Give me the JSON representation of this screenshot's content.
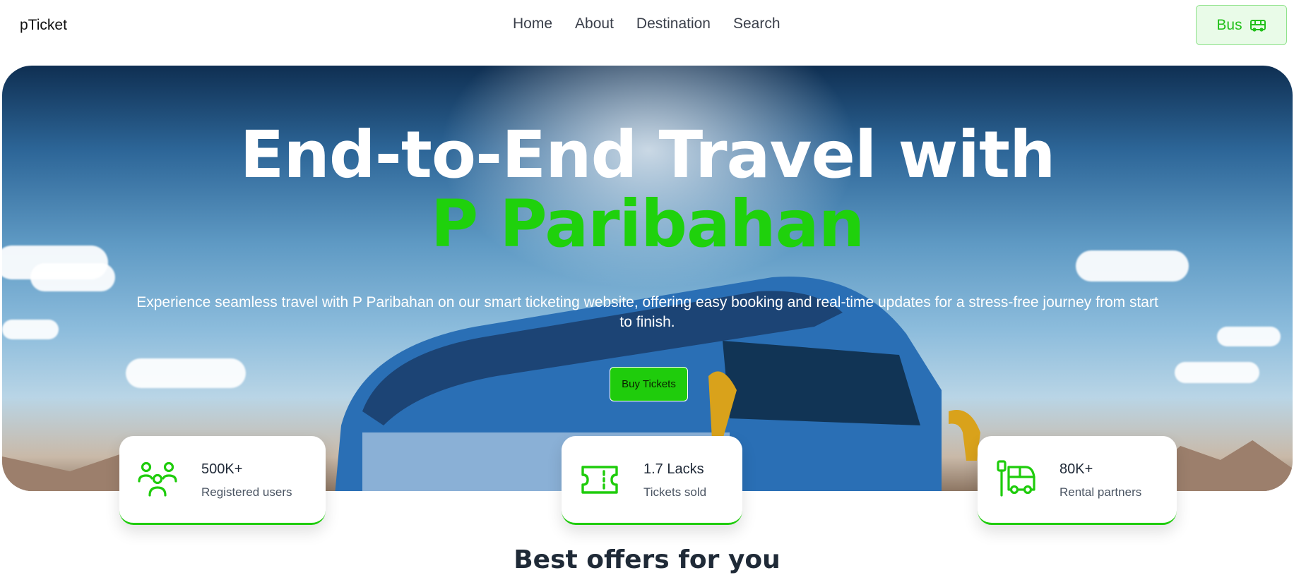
{
  "brand": "pTicket",
  "nav": {
    "links": [
      "Home",
      "About",
      "Destination",
      "Search"
    ],
    "bus_button": "Bus",
    "bus_icon": "bus-icon"
  },
  "hero": {
    "title_line1": "End-to-End Travel with",
    "title_line2": "P Paribahan",
    "subtitle": "Experience seamless travel with P Paribahan on our smart ticketing website, offering easy booking and real-time updates for a stress-free journey from start to finish.",
    "cta": "Buy Tickets"
  },
  "stats": [
    {
      "value": "500K+",
      "label": "Registered users",
      "icon": "users-icon"
    },
    {
      "value": "1.7 Lacks",
      "label": "Tickets sold",
      "icon": "ticket-icon"
    },
    {
      "value": "80K+",
      "label": "Rental partners",
      "icon": "bus-stop-icon"
    }
  ],
  "section_title": "Best offers for you",
  "colors": {
    "accent": "#1fcc0c",
    "accent_light": "#e9fbe8",
    "text": "#1f2937"
  }
}
